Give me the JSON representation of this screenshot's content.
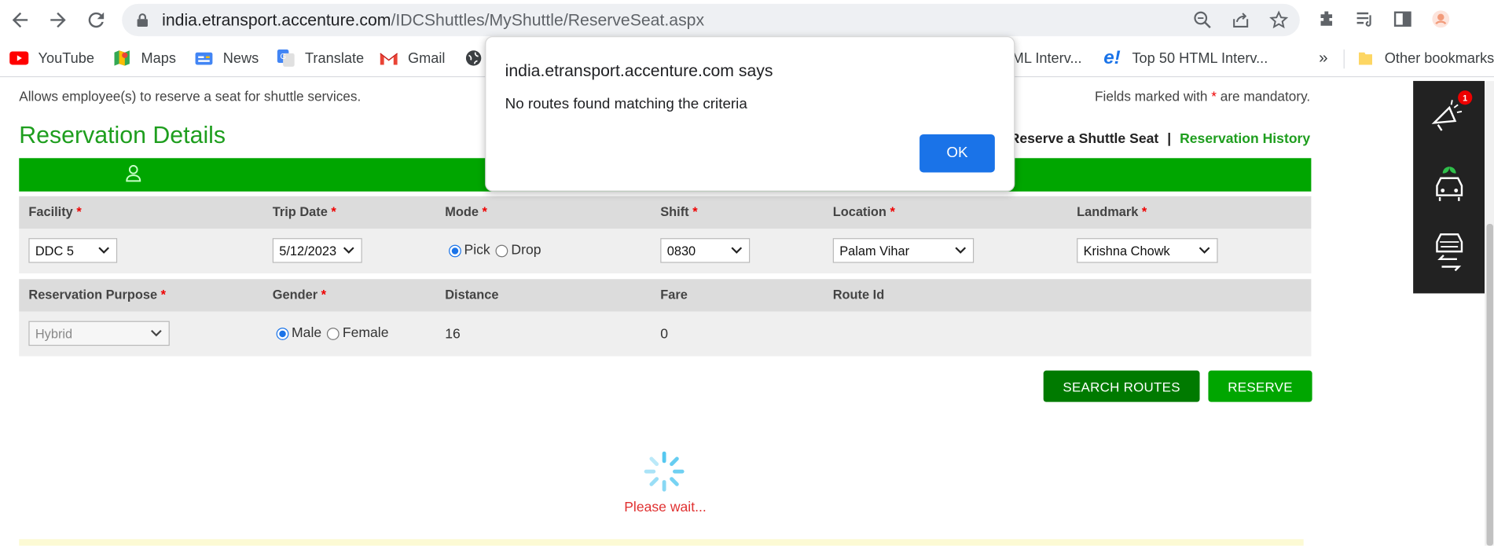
{
  "browser": {
    "url_host": "india.etransport.accenture.com",
    "url_path": "/IDCShuttles/MyShuttle/ReserveSeat.aspx",
    "bookmarks": [
      "YouTube",
      "Maps",
      "News",
      "Translate",
      "Gmail",
      "ML Interv...",
      "Top 50 HTML Interv..."
    ],
    "overflow_chevron": "»",
    "other_bookmarks": "Other bookmarks"
  },
  "page": {
    "intro": "Allows employee(s) to reserve a seat for shuttle services.",
    "mandatory_prefix": "Fields marked with",
    "mandatory_star": "*",
    "mandatory_suffix": "are mandatory.",
    "title": "Reservation Details",
    "link_reserve": "Reserve a Shuttle Seat",
    "link_separator": "|",
    "link_history": "Reservation History"
  },
  "form": {
    "star": "*",
    "facility_label": "Facility",
    "facility_value": "DDC 5",
    "trip_date_label": "Trip Date",
    "trip_date_value": "5/12/2023",
    "mode_label": "Mode",
    "mode_pick": "Pick",
    "mode_drop": "Drop",
    "mode_selected": "Pick",
    "shift_label": "Shift",
    "shift_value": "0830",
    "location_label": "Location",
    "location_value": "Palam Vihar",
    "landmark_label": "Landmark",
    "landmark_value": "Krishna Chowk",
    "purpose_label": "Reservation Purpose",
    "purpose_value": "Hybrid",
    "gender_label": "Gender",
    "gender_male": "Male",
    "gender_female": "Female",
    "gender_selected": "Male",
    "distance_label": "Distance",
    "distance_value": "16",
    "fare_label": "Fare",
    "fare_value": "0",
    "route_id_label": "Route Id"
  },
  "buttons": {
    "search_routes": "SEARCH ROUTES",
    "reserve": "RESERVE"
  },
  "loading_text": "Please wait...",
  "side_panel": {
    "notification_count": "1"
  },
  "dialog": {
    "title": "india.etransport.accenture.com says",
    "message": "No routes found matching the criteria",
    "ok": "OK"
  },
  "colors": {
    "brand_green": "#00a600",
    "dark_green_button": "#008000",
    "dialog_button": "#1a73e8",
    "loading_text": "#e03030"
  }
}
